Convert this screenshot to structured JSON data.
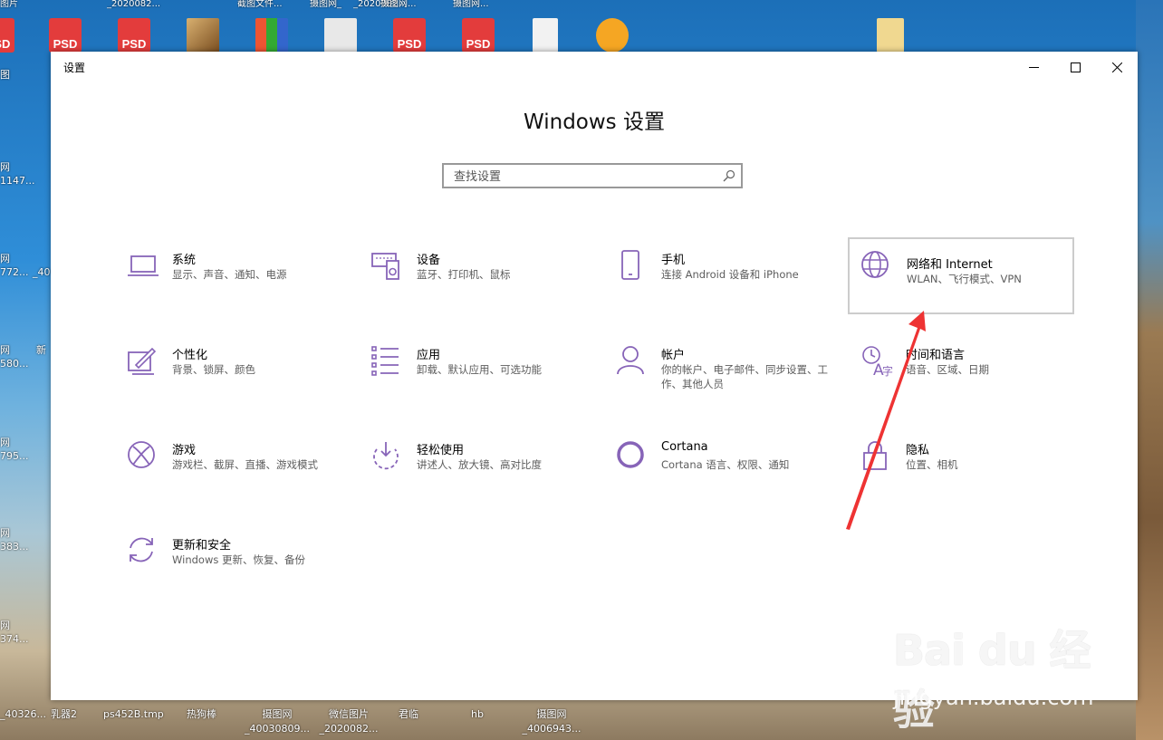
{
  "desktop": {
    "top_labels": [
      "图片",
      "_2020082...",
      "截图文件...",
      "摄图网_",
      "_2020082...",
      "摄图网...",
      "摄图网..."
    ],
    "bottom_labels": [
      "_40326...",
      "乳器2",
      "ps452B.tmp",
      "热狗棒",
      "摄图网_40030809...",
      "微信图片_2020082...",
      "君临",
      "hb",
      "摄图网_4006943..."
    ],
    "left_labels": [
      "图",
      "网",
      "1147...",
      "网",
      "772...",
      "_40",
      "网",
      "580...",
      "新",
      "网",
      "795...",
      "网",
      "383...",
      "网",
      "374..."
    ],
    "psd_label": "PSD"
  },
  "window": {
    "title": "设置",
    "heading": "Windows 设置",
    "search_placeholder": "查找设置",
    "buttons": {
      "minimize": "minimize",
      "maximize": "maximize",
      "close": "close"
    }
  },
  "tiles": [
    {
      "title": "系统",
      "subtitle": "显示、声音、通知、电源",
      "icon": "laptop-icon"
    },
    {
      "title": "设备",
      "subtitle": "蓝牙、打印机、鼠标",
      "icon": "devices-icon"
    },
    {
      "title": "手机",
      "subtitle": "连接 Android 设备和 iPhone",
      "icon": "phone-icon"
    },
    {
      "title": "网络和 Internet",
      "subtitle": "WLAN、飞行模式、VPN",
      "icon": "globe-icon"
    },
    {
      "title": "个性化",
      "subtitle": "背景、锁屏、颜色",
      "icon": "personalization-icon"
    },
    {
      "title": "应用",
      "subtitle": "卸载、默认应用、可选功能",
      "icon": "apps-icon"
    },
    {
      "title": "帐户",
      "subtitle": "你的帐户、电子邮件、同步设置、工作、其他人员",
      "icon": "account-icon"
    },
    {
      "title": "时间和语言",
      "subtitle": "语音、区域、日期",
      "icon": "time-language-icon"
    },
    {
      "title": "游戏",
      "subtitle": "游戏栏、截屏、直播、游戏模式",
      "icon": "xbox-icon"
    },
    {
      "title": "轻松使用",
      "subtitle": "讲述人、放大镜、高对比度",
      "icon": "ease-of-access-icon"
    },
    {
      "title": "Cortana",
      "subtitle": "Cortana 语言、权限、通知",
      "icon": "cortana-icon"
    },
    {
      "title": "隐私",
      "subtitle": "位置、相机",
      "icon": "lock-icon"
    },
    {
      "title": "更新和安全",
      "subtitle": "Windows 更新、恢复、备份",
      "icon": "update-icon"
    }
  ],
  "watermark": {
    "logo": "Bai du 经验",
    "url": "jingyan.baidu.com"
  },
  "colors": {
    "accent": "#8764b8",
    "arrow": "#ee3333",
    "highlight_border": "#cccccc"
  }
}
